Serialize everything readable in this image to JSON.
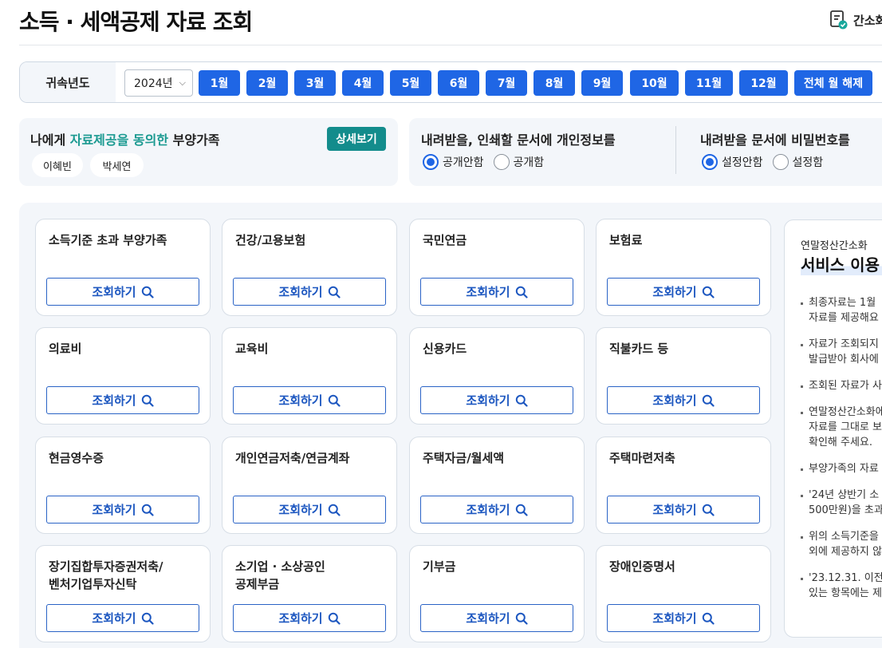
{
  "header": {
    "title": "소득 · 세액공제 자료 조회",
    "simple_link": "간소화"
  },
  "year_bar": {
    "label": "귀속년도",
    "selected_year": "2024년",
    "months": [
      "1월",
      "2월",
      "3월",
      "4월",
      "5월",
      "6월",
      "7월",
      "8월",
      "9월",
      "10월",
      "11월",
      "12월"
    ],
    "clear_all": "전체 월 해제"
  },
  "dependents": {
    "title_pre": "나에게 ",
    "title_highlight": "자료제공을 동의한",
    "title_post": " 부양가족",
    "detail_button": "상세보기",
    "members": [
      "이혜빈",
      "박세연"
    ]
  },
  "privacy_option": {
    "title": "내려받을, 인쇄할 문서에 개인정보를",
    "options": [
      "공개안함",
      "공개함"
    ],
    "selected": "공개안함"
  },
  "password_option": {
    "title": "내려받을 문서에 비밀번호를",
    "options": [
      "설정안함",
      "설정함"
    ],
    "selected": "설정안함"
  },
  "query_button_label": "조회하기",
  "cards": [
    {
      "title": "소득기준 초과 부양가족"
    },
    {
      "title": "건강/고용보험"
    },
    {
      "title": "국민연금"
    },
    {
      "title": "보험료"
    },
    {
      "title": "의료비"
    },
    {
      "title": "교육비"
    },
    {
      "title": "신용카드"
    },
    {
      "title": "직불카드 등"
    },
    {
      "title": "현금영수증"
    },
    {
      "title": "개인연금저축/연금계좌"
    },
    {
      "title": "주택자금/월세액"
    },
    {
      "title": "주택마련저축"
    },
    {
      "title": "장기집합투자증권저축/\n벤처기업투자신탁"
    },
    {
      "title": "소기업 · 소상공인\n공제부금"
    },
    {
      "title": "기부금"
    },
    {
      "title": "장애인증명서"
    }
  ],
  "info": {
    "subtitle": "연말정산간소화",
    "title": "서비스 이용",
    "notes": [
      "최종자료는 1월\n자료를 제공해요",
      "자료가 조회되지\n발급받아 회사에",
      "조회된 자료가 사",
      "연말정산간소화에\n자료를 그대로 보\n확인해 주세요.",
      "부양가족의 자료",
      "'24년 상반기 소\n500만원)을 초과",
      "위의 소득기준을\n외에 제공하지 않",
      "'23.12.31. 이전\n있는 항목에는 제"
    ]
  },
  "colors": {
    "primary": "#1f66e5",
    "teal": "#138c8c",
    "highlight_text": "#1b9a91",
    "panel_bg": "#f3f6fa"
  }
}
